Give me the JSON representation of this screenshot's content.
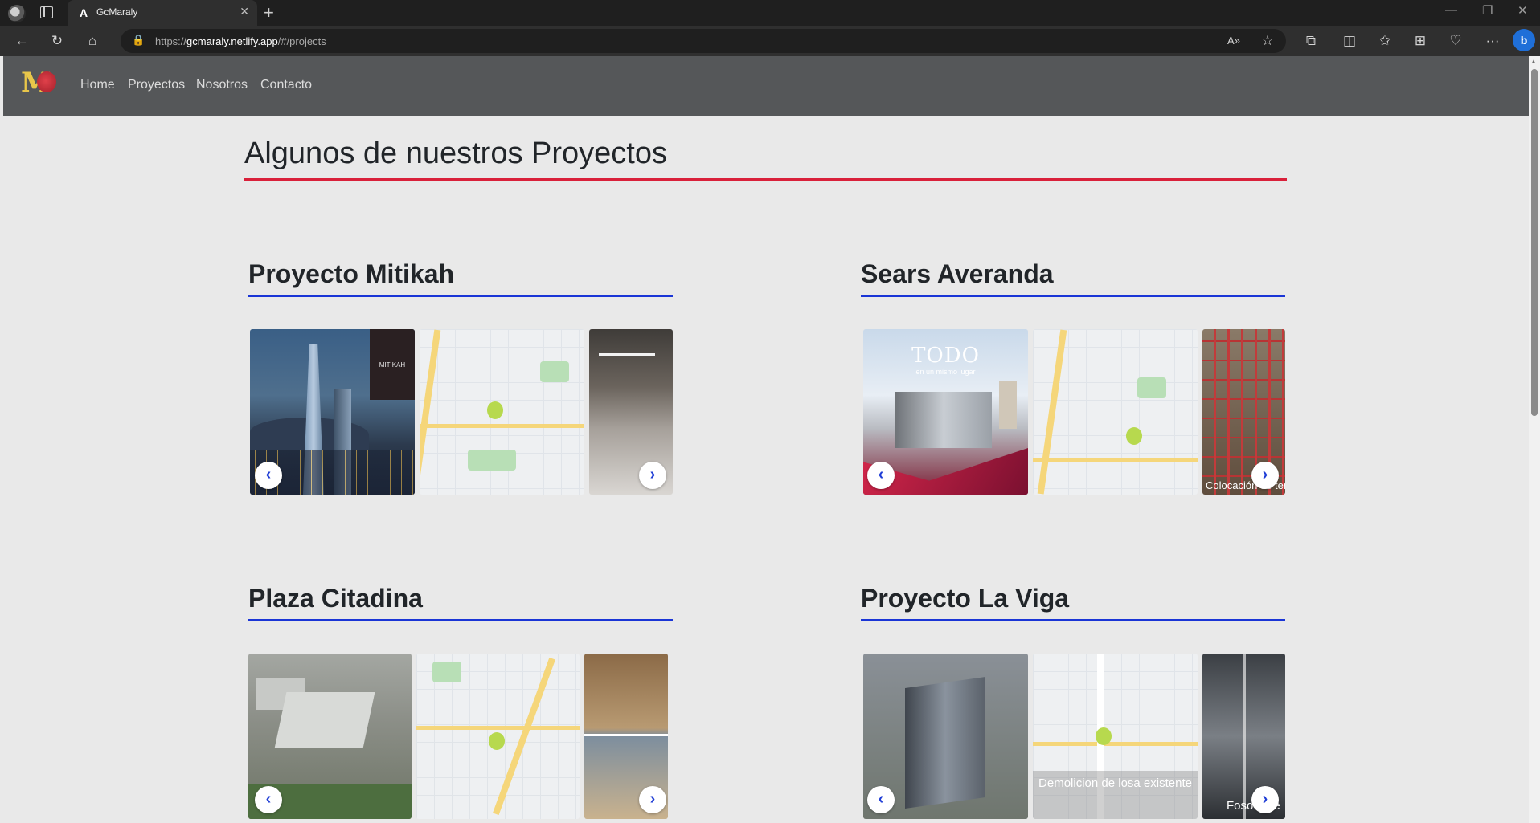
{
  "browser": {
    "tab_title": "GcMaraly",
    "tab_favicon": "A",
    "url_prefix": "https://",
    "url_host": "gcmaraly.netlify.app",
    "url_path": "/#/projects"
  },
  "site": {
    "nav": [
      {
        "label": "Home"
      },
      {
        "label": "Proyectos"
      },
      {
        "label": "Nosotros"
      },
      {
        "label": "Contacto"
      }
    ],
    "page_title": "Algunos de nuestros Proyectos",
    "accent_red": "#d9203a",
    "accent_blue": "#1a35d6"
  },
  "projects": [
    {
      "title": "Proyecto Mitikah",
      "panel_text": "MITIKAH"
    },
    {
      "title": "Sears Averanda",
      "slide1_heading": "TODO",
      "slide1_sub": "en un mismo lugar",
      "slide3_caption": "Colocación de tensado"
    },
    {
      "title": "Plaza Citadina"
    },
    {
      "title": "Proyecto La Viga",
      "slide2_caption": "Demolicion de losa existente",
      "slide3_caption": "Foso de e"
    }
  ],
  "carousel": {
    "prev": "‹",
    "next": "›"
  }
}
